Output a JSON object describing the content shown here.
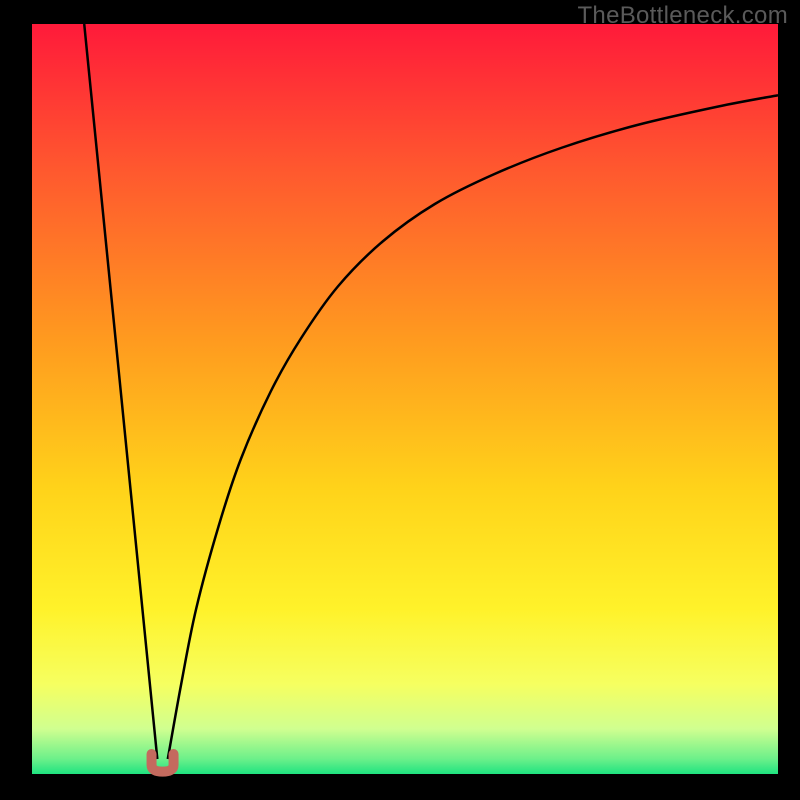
{
  "watermark": "TheBottleneck.com",
  "chart_data": {
    "type": "line",
    "title": "",
    "xlabel": "",
    "ylabel": "",
    "xlim": [
      0,
      100
    ],
    "ylim": [
      0,
      100
    ],
    "background": {
      "type": "vertical-gradient",
      "stops": [
        {
          "pos": 0.0,
          "color": "#ff1a3a"
        },
        {
          "pos": 0.2,
          "color": "#ff5a2e"
        },
        {
          "pos": 0.42,
          "color": "#ff9a1f"
        },
        {
          "pos": 0.62,
          "color": "#ffd31a"
        },
        {
          "pos": 0.78,
          "color": "#fff22a"
        },
        {
          "pos": 0.88,
          "color": "#f6ff60"
        },
        {
          "pos": 0.94,
          "color": "#d0ff90"
        },
        {
          "pos": 0.98,
          "color": "#6cf08a"
        },
        {
          "pos": 1.0,
          "color": "#1fe380"
        }
      ]
    },
    "minimum_marker": {
      "x": 17.5,
      "y": 1.2,
      "color": "#c46a5e"
    },
    "series": [
      {
        "name": "left-branch",
        "x": [
          7.0,
          8.0,
          9.0,
          10.0,
          11.0,
          12.0,
          13.0,
          14.0,
          15.0,
          16.0,
          16.8
        ],
        "y": [
          100,
          90,
          80,
          70,
          60,
          50,
          40,
          30,
          20,
          10,
          2.0
        ]
      },
      {
        "name": "right-branch",
        "x": [
          18.2,
          20,
          22,
          25,
          28,
          32,
          36,
          41,
          47,
          54,
          62,
          71,
          81,
          92,
          100
        ],
        "y": [
          2.0,
          12,
          22,
          33,
          42,
          51,
          58,
          65,
          71,
          76,
          80,
          83.5,
          86.5,
          89,
          90.5
        ]
      }
    ]
  }
}
